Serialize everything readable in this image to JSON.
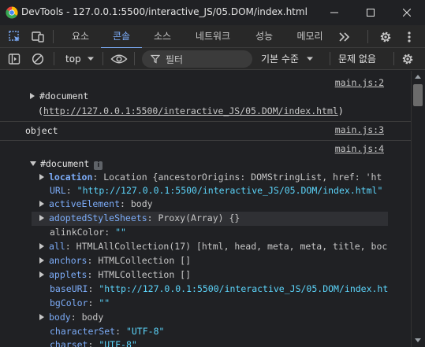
{
  "window": {
    "title": "DevTools - 127.0.0.1:5500/interactive_JS/05.DOM/index.html"
  },
  "tabs": [
    {
      "label": "요소"
    },
    {
      "label": "콘솔",
      "active": true
    },
    {
      "label": "소스"
    },
    {
      "label": "네트워크"
    },
    {
      "label": "성능"
    },
    {
      "label": "메모리"
    }
  ],
  "toolbar": {
    "context": "top",
    "filter_placeholder": "필터",
    "level": "기본 수준",
    "issues": "문제 없음"
  },
  "console": {
    "entries": [
      {
        "source": "main.js:2",
        "text": "#document",
        "link": "http://127.0.0.1:5500/interactive_JS/05.DOM/index.html"
      },
      {
        "source": "main.js:3",
        "text": "object"
      },
      {
        "source": "main.js:4",
        "text": "#document"
      }
    ],
    "props": [
      {
        "key": "location",
        "value": "Location {ancestorOrigins: DOMStringList, href: 'ht"
      },
      {
        "key": "URL",
        "value": "\"http://127.0.0.1:5500/interactive_JS/05.DOM/index.html\""
      },
      {
        "key": "activeElement",
        "value": "body"
      },
      {
        "key": "adoptedStyleSheets",
        "value": "Proxy(Array) {}"
      },
      {
        "key": "alinkColor",
        "value": "\"\""
      },
      {
        "key": "all",
        "value": "HTMLAllCollection(17) [html, head, meta, meta, title, boc"
      },
      {
        "key": "anchors",
        "value": "HTMLCollection []"
      },
      {
        "key": "applets",
        "value": "HTMLCollection []"
      },
      {
        "key": "baseURI",
        "value": "\"http://127.0.0.1:5500/interactive_JS/05.DOM/index.ht"
      },
      {
        "key": "bgColor",
        "value": "\"\""
      },
      {
        "key": "body",
        "value": "body"
      },
      {
        "key": "characterSet",
        "value": "\"UTF-8\""
      },
      {
        "key": "charset",
        "value": "\"UTF-8\""
      }
    ]
  },
  "colors": {
    "accent": "#7cacf8",
    "background": "#202124",
    "toolbar": "#282828"
  }
}
